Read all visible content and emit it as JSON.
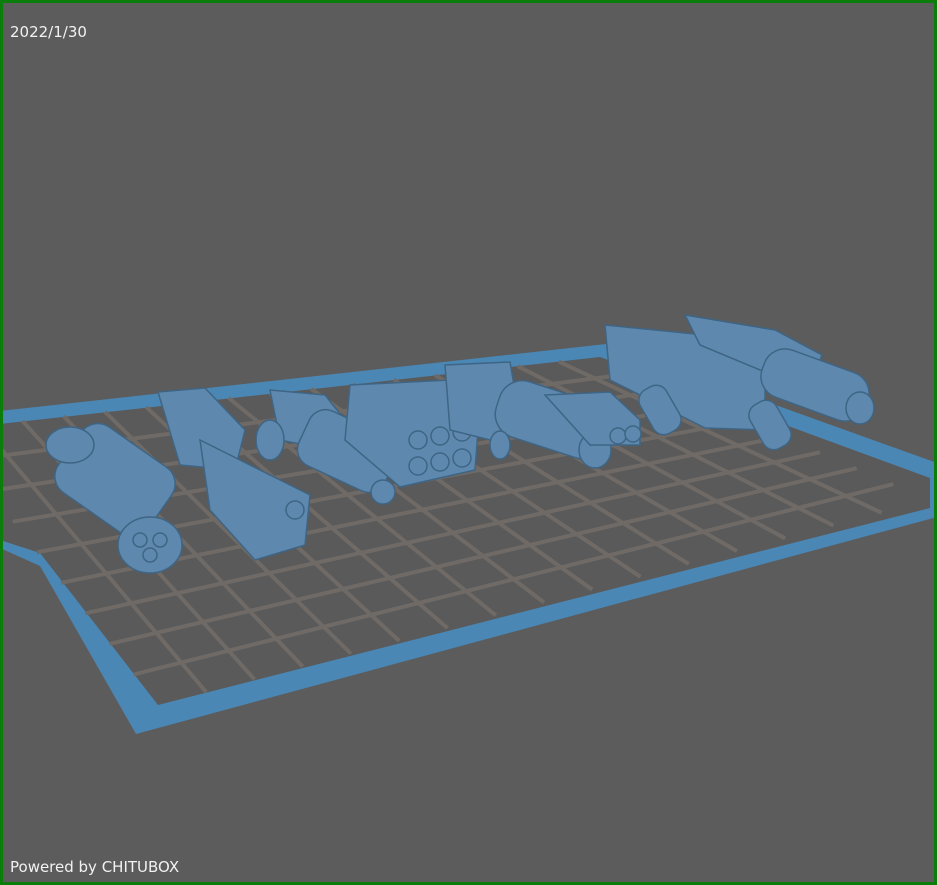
{
  "overlay": {
    "date": "2022/1/30",
    "powered_by": "Powered by CHITUBOX"
  },
  "colors": {
    "background": "#5c5c5c",
    "border": "#0a7d0a",
    "plate_edge": "#4a87b5",
    "plate_grid": "#6f6a66",
    "model": "#5e88ae"
  }
}
